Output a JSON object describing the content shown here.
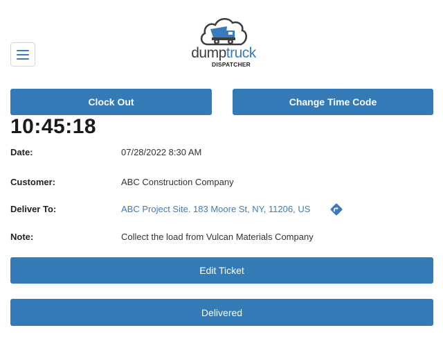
{
  "header": {
    "menu_icon": "hamburger-menu-icon",
    "logo": {
      "word_dump": "dump",
      "word_truck": "truck",
      "subtitle": "DISPATCHER",
      "icon": "dump-truck-cloud-icon"
    }
  },
  "actions": {
    "clock_out_label": "Clock Out",
    "change_time_code_label": "Change Time Code"
  },
  "timer": {
    "value": "10:45:18"
  },
  "ticket": {
    "date": {
      "label": "Date:",
      "value": "07/28/2022 8:30 AM"
    },
    "customer": {
      "label": "Customer:",
      "value": "ABC Construction Company"
    },
    "deliver_to": {
      "label": "Deliver To:",
      "value": "ABC Project Site. 183 Moore St, NY, 11206, US",
      "icon": "directions-icon"
    },
    "note": {
      "label": "Note:",
      "value": "Collect the load from Vulcan Materials Company"
    }
  },
  "footer_actions": {
    "edit_label": "Edit Ticket",
    "delivered_label": "Delivered"
  },
  "colors": {
    "primary": "#337ab7",
    "link": "#3a7bbf",
    "text": "#222222"
  }
}
